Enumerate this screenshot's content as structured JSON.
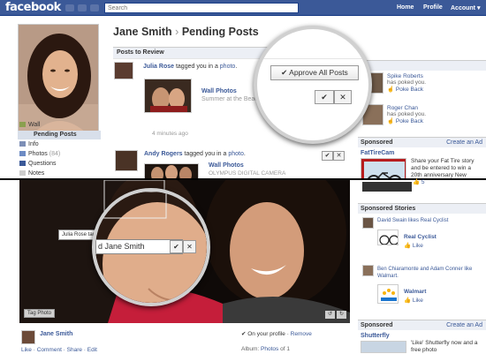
{
  "topbar": {
    "logo": "facebook",
    "search_placeholder": "Search",
    "links": [
      "Home",
      "Profile",
      "Account ▾"
    ]
  },
  "left_nav": {
    "wall": "Wall",
    "pending": "Pending Posts",
    "info": "Info",
    "photos": "Photos",
    "photos_count": "(84)",
    "questions": "Questions",
    "notes": "Notes"
  },
  "header": {
    "name": "Jane Smith",
    "arrow": "›",
    "section": "Pending Posts"
  },
  "posts_to_review": "Posts to Review",
  "approve_all": "✔ Approve All Posts",
  "posts": [
    {
      "author": "Julia Rose",
      "text": " tagged you in a ",
      "obj": "photo",
      "end": ".",
      "album": "Wall Photos",
      "caption": "Summer at the Beach Ho",
      "time": "4 minutes ago"
    },
    {
      "author": "Andy Rogers",
      "text": " tagged you in a ",
      "obj": "photo",
      "end": ".",
      "album": "Wall Photos",
      "caption": "OLYMPUS DIGITAL CAMERA"
    }
  ],
  "right": {
    "pokes_header": "es",
    "pokes": [
      {
        "name": "Spike Roberts",
        "text": "has poked you.",
        "action": "Poke Back"
      },
      {
        "name": "Roger Chan",
        "text": "has poked you.",
        "action": "Poke Back"
      }
    ],
    "sponsored": "Sponsored",
    "create_ad": "Create an Ad",
    "ad_title": "FatTireCam",
    "ad_text": "Share your Fat Tire story and be entered to win a 20th anniversary New Belgium cruiser."
  },
  "tagging": {
    "tagger": "Julia Rose tagg",
    "name": "d Jane Smith",
    "tag_photo": "Tag Photo"
  },
  "lower_right": {
    "likes_row": "👍 5",
    "sponsored_stories": "Sponsored Stories",
    "story1": "David Swain likes Real Cyclist",
    "story1_page": "Real Cyclist",
    "story1_like": "Like",
    "story2": "Ben Chiaramonte and Adam Conner like Walmart.",
    "story2_page": "Walmart",
    "story2_like": "Like",
    "sponsored": "Sponsored",
    "create_ad": "Create an Ad",
    "ad_title": "Shutterfly",
    "ad_text": "'Like' Shutterfly now and a free photo"
  },
  "bottom": {
    "name": "Jane Smith",
    "actions": "Like · Comment · Share · Edit",
    "on_profile": "✔ On your profile · ",
    "remove": "Remove",
    "album_label": "Album: ",
    "album": "Photos",
    "album_rest": " of 1 "
  },
  "colors": {
    "brand": "#3b5998",
    "nav_selected": "#d8dfea"
  }
}
